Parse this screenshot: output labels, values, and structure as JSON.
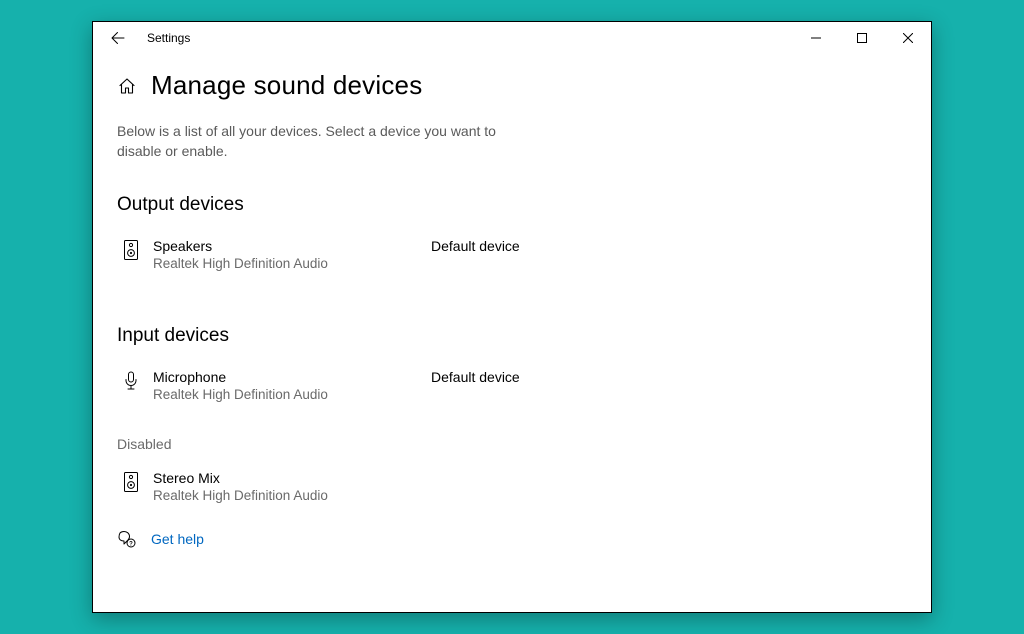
{
  "titlebar": {
    "app_name": "Settings"
  },
  "page": {
    "title": "Manage sound devices",
    "description": "Below is a list of all your devices. Select a device you want to disable or enable."
  },
  "sections": {
    "output": {
      "heading": "Output devices",
      "devices": [
        {
          "name": "Speakers",
          "sub": "Realtek High Definition Audio",
          "status": "Default device"
        }
      ]
    },
    "input": {
      "heading": "Input devices",
      "devices": [
        {
          "name": "Microphone",
          "sub": "Realtek High Definition Audio",
          "status": "Default device"
        }
      ],
      "disabled_label": "Disabled",
      "disabled_devices": [
        {
          "name": "Stereo Mix",
          "sub": "Realtek High Definition Audio"
        }
      ]
    }
  },
  "help": {
    "label": "Get help"
  }
}
